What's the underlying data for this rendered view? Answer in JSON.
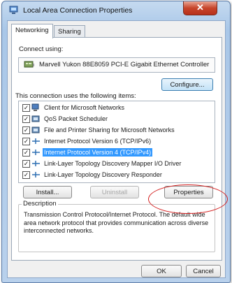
{
  "window": {
    "title": "Local Area Connection Properties",
    "close_label": "✕"
  },
  "tabs": [
    {
      "label": "Networking",
      "active": true
    },
    {
      "label": "Sharing",
      "active": false
    }
  ],
  "connect_using": {
    "label": "Connect using:",
    "adapter": "Marvell Yukon 88E8059 PCI-E Gigabit Ethernet Controller",
    "configure_label": "Configure..."
  },
  "items_section": {
    "label": "This connection uses the following items:",
    "items": [
      {
        "label": "Client for Microsoft Networks",
        "checked": true,
        "icon": "network-client-icon",
        "selected": false
      },
      {
        "label": "QoS Packet Scheduler",
        "checked": true,
        "icon": "service-icon",
        "selected": false
      },
      {
        "label": "File and Printer Sharing for Microsoft Networks",
        "checked": true,
        "icon": "service-icon",
        "selected": false
      },
      {
        "label": "Internet Protocol Version 6 (TCP/IPv6)",
        "checked": true,
        "icon": "protocol-icon",
        "selected": false
      },
      {
        "label": "Internet Protocol Version 4 (TCP/IPv4)",
        "checked": true,
        "icon": "protocol-icon",
        "selected": true
      },
      {
        "label": "Link-Layer Topology Discovery Mapper I/O Driver",
        "checked": true,
        "icon": "protocol-icon",
        "selected": false
      },
      {
        "label": "Link-Layer Topology Discovery Responder",
        "checked": true,
        "icon": "protocol-icon",
        "selected": false
      }
    ]
  },
  "actions": {
    "install_label": "Install...",
    "uninstall_label": "Uninstall",
    "properties_label": "Properties"
  },
  "description": {
    "legend": "Description",
    "text": "Transmission Control Protocol/Internet Protocol. The default wide area network protocol that provides communication across diverse interconnected networks."
  },
  "footer": {
    "ok_label": "OK",
    "cancel_label": "Cancel"
  },
  "colors": {
    "selection": "#3399ff",
    "annotation": "#d42020",
    "title_bar": "#b9d1ec",
    "close_button": "#c7452b"
  }
}
